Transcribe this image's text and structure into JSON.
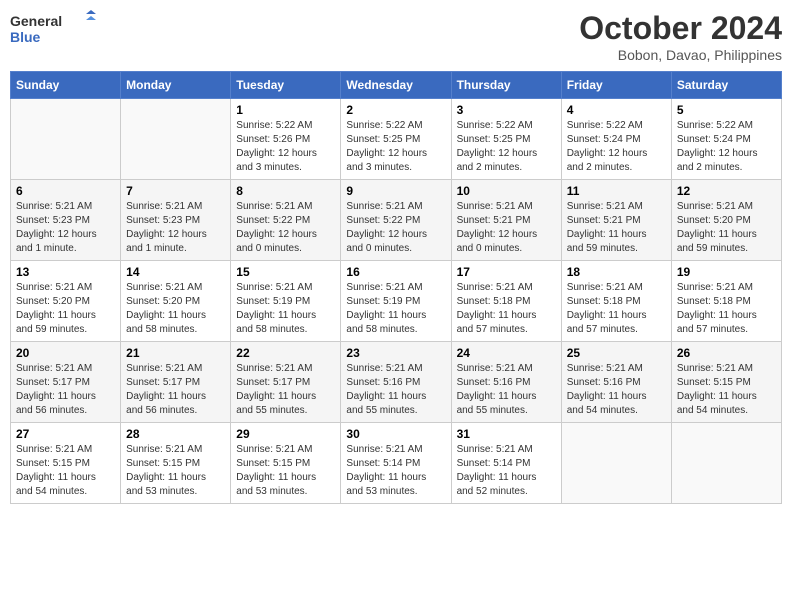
{
  "header": {
    "logo_line1": "General",
    "logo_line2": "Blue",
    "month_title": "October 2024",
    "subtitle": "Bobon, Davao, Philippines"
  },
  "weekdays": [
    "Sunday",
    "Monday",
    "Tuesday",
    "Wednesday",
    "Thursday",
    "Friday",
    "Saturday"
  ],
  "weeks": [
    [
      {
        "day": "",
        "detail": ""
      },
      {
        "day": "",
        "detail": ""
      },
      {
        "day": "1",
        "detail": "Sunrise: 5:22 AM\nSunset: 5:26 PM\nDaylight: 12 hours and 3 minutes."
      },
      {
        "day": "2",
        "detail": "Sunrise: 5:22 AM\nSunset: 5:25 PM\nDaylight: 12 hours and 3 minutes."
      },
      {
        "day": "3",
        "detail": "Sunrise: 5:22 AM\nSunset: 5:25 PM\nDaylight: 12 hours and 2 minutes."
      },
      {
        "day": "4",
        "detail": "Sunrise: 5:22 AM\nSunset: 5:24 PM\nDaylight: 12 hours and 2 minutes."
      },
      {
        "day": "5",
        "detail": "Sunrise: 5:22 AM\nSunset: 5:24 PM\nDaylight: 12 hours and 2 minutes."
      }
    ],
    [
      {
        "day": "6",
        "detail": "Sunrise: 5:21 AM\nSunset: 5:23 PM\nDaylight: 12 hours and 1 minute."
      },
      {
        "day": "7",
        "detail": "Sunrise: 5:21 AM\nSunset: 5:23 PM\nDaylight: 12 hours and 1 minute."
      },
      {
        "day": "8",
        "detail": "Sunrise: 5:21 AM\nSunset: 5:22 PM\nDaylight: 12 hours and 0 minutes."
      },
      {
        "day": "9",
        "detail": "Sunrise: 5:21 AM\nSunset: 5:22 PM\nDaylight: 12 hours and 0 minutes."
      },
      {
        "day": "10",
        "detail": "Sunrise: 5:21 AM\nSunset: 5:21 PM\nDaylight: 12 hours and 0 minutes."
      },
      {
        "day": "11",
        "detail": "Sunrise: 5:21 AM\nSunset: 5:21 PM\nDaylight: 11 hours and 59 minutes."
      },
      {
        "day": "12",
        "detail": "Sunrise: 5:21 AM\nSunset: 5:20 PM\nDaylight: 11 hours and 59 minutes."
      }
    ],
    [
      {
        "day": "13",
        "detail": "Sunrise: 5:21 AM\nSunset: 5:20 PM\nDaylight: 11 hours and 59 minutes."
      },
      {
        "day": "14",
        "detail": "Sunrise: 5:21 AM\nSunset: 5:20 PM\nDaylight: 11 hours and 58 minutes."
      },
      {
        "day": "15",
        "detail": "Sunrise: 5:21 AM\nSunset: 5:19 PM\nDaylight: 11 hours and 58 minutes."
      },
      {
        "day": "16",
        "detail": "Sunrise: 5:21 AM\nSunset: 5:19 PM\nDaylight: 11 hours and 58 minutes."
      },
      {
        "day": "17",
        "detail": "Sunrise: 5:21 AM\nSunset: 5:18 PM\nDaylight: 11 hours and 57 minutes."
      },
      {
        "day": "18",
        "detail": "Sunrise: 5:21 AM\nSunset: 5:18 PM\nDaylight: 11 hours and 57 minutes."
      },
      {
        "day": "19",
        "detail": "Sunrise: 5:21 AM\nSunset: 5:18 PM\nDaylight: 11 hours and 57 minutes."
      }
    ],
    [
      {
        "day": "20",
        "detail": "Sunrise: 5:21 AM\nSunset: 5:17 PM\nDaylight: 11 hours and 56 minutes."
      },
      {
        "day": "21",
        "detail": "Sunrise: 5:21 AM\nSunset: 5:17 PM\nDaylight: 11 hours and 56 minutes."
      },
      {
        "day": "22",
        "detail": "Sunrise: 5:21 AM\nSunset: 5:17 PM\nDaylight: 11 hours and 55 minutes."
      },
      {
        "day": "23",
        "detail": "Sunrise: 5:21 AM\nSunset: 5:16 PM\nDaylight: 11 hours and 55 minutes."
      },
      {
        "day": "24",
        "detail": "Sunrise: 5:21 AM\nSunset: 5:16 PM\nDaylight: 11 hours and 55 minutes."
      },
      {
        "day": "25",
        "detail": "Sunrise: 5:21 AM\nSunset: 5:16 PM\nDaylight: 11 hours and 54 minutes."
      },
      {
        "day": "26",
        "detail": "Sunrise: 5:21 AM\nSunset: 5:15 PM\nDaylight: 11 hours and 54 minutes."
      }
    ],
    [
      {
        "day": "27",
        "detail": "Sunrise: 5:21 AM\nSunset: 5:15 PM\nDaylight: 11 hours and 54 minutes."
      },
      {
        "day": "28",
        "detail": "Sunrise: 5:21 AM\nSunset: 5:15 PM\nDaylight: 11 hours and 53 minutes."
      },
      {
        "day": "29",
        "detail": "Sunrise: 5:21 AM\nSunset: 5:15 PM\nDaylight: 11 hours and 53 minutes."
      },
      {
        "day": "30",
        "detail": "Sunrise: 5:21 AM\nSunset: 5:14 PM\nDaylight: 11 hours and 53 minutes."
      },
      {
        "day": "31",
        "detail": "Sunrise: 5:21 AM\nSunset: 5:14 PM\nDaylight: 11 hours and 52 minutes."
      },
      {
        "day": "",
        "detail": ""
      },
      {
        "day": "",
        "detail": ""
      }
    ]
  ]
}
